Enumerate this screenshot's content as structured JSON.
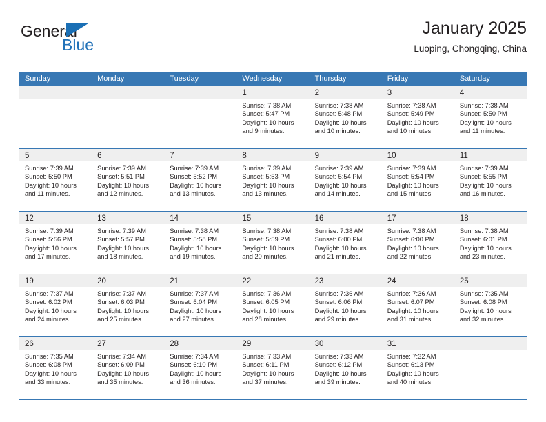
{
  "brand": {
    "name_part1": "General",
    "name_part2": "Blue",
    "colors": {
      "general": "#231f20",
      "blue": "#2272b8",
      "triangle": "#1a6fb5"
    }
  },
  "header": {
    "title": "January 2025",
    "subtitle": "Luoping, Chongqing, China"
  },
  "theme": {
    "header_row_bg": "#3878b4",
    "header_row_text": "#ffffff",
    "daynum_band_bg": "#efefef",
    "row_divider": "#3878b4",
    "text": "#231f20"
  },
  "calendar": {
    "weekday_headers": [
      "Sunday",
      "Monday",
      "Tuesday",
      "Wednesday",
      "Thursday",
      "Friday",
      "Saturday"
    ],
    "weeks": [
      [
        {
          "day": "",
          "lines": []
        },
        {
          "day": "",
          "lines": []
        },
        {
          "day": "",
          "lines": []
        },
        {
          "day": "1",
          "lines": [
            "Sunrise: 7:38 AM",
            "Sunset: 5:47 PM",
            "Daylight: 10 hours",
            "and 9 minutes."
          ]
        },
        {
          "day": "2",
          "lines": [
            "Sunrise: 7:38 AM",
            "Sunset: 5:48 PM",
            "Daylight: 10 hours",
            "and 10 minutes."
          ]
        },
        {
          "day": "3",
          "lines": [
            "Sunrise: 7:38 AM",
            "Sunset: 5:49 PM",
            "Daylight: 10 hours",
            "and 10 minutes."
          ]
        },
        {
          "day": "4",
          "lines": [
            "Sunrise: 7:38 AM",
            "Sunset: 5:50 PM",
            "Daylight: 10 hours",
            "and 11 minutes."
          ]
        }
      ],
      [
        {
          "day": "5",
          "lines": [
            "Sunrise: 7:39 AM",
            "Sunset: 5:50 PM",
            "Daylight: 10 hours",
            "and 11 minutes."
          ]
        },
        {
          "day": "6",
          "lines": [
            "Sunrise: 7:39 AM",
            "Sunset: 5:51 PM",
            "Daylight: 10 hours",
            "and 12 minutes."
          ]
        },
        {
          "day": "7",
          "lines": [
            "Sunrise: 7:39 AM",
            "Sunset: 5:52 PM",
            "Daylight: 10 hours",
            "and 13 minutes."
          ]
        },
        {
          "day": "8",
          "lines": [
            "Sunrise: 7:39 AM",
            "Sunset: 5:53 PM",
            "Daylight: 10 hours",
            "and 13 minutes."
          ]
        },
        {
          "day": "9",
          "lines": [
            "Sunrise: 7:39 AM",
            "Sunset: 5:54 PM",
            "Daylight: 10 hours",
            "and 14 minutes."
          ]
        },
        {
          "day": "10",
          "lines": [
            "Sunrise: 7:39 AM",
            "Sunset: 5:54 PM",
            "Daylight: 10 hours",
            "and 15 minutes."
          ]
        },
        {
          "day": "11",
          "lines": [
            "Sunrise: 7:39 AM",
            "Sunset: 5:55 PM",
            "Daylight: 10 hours",
            "and 16 minutes."
          ]
        }
      ],
      [
        {
          "day": "12",
          "lines": [
            "Sunrise: 7:39 AM",
            "Sunset: 5:56 PM",
            "Daylight: 10 hours",
            "and 17 minutes."
          ]
        },
        {
          "day": "13",
          "lines": [
            "Sunrise: 7:39 AM",
            "Sunset: 5:57 PM",
            "Daylight: 10 hours",
            "and 18 minutes."
          ]
        },
        {
          "day": "14",
          "lines": [
            "Sunrise: 7:38 AM",
            "Sunset: 5:58 PM",
            "Daylight: 10 hours",
            "and 19 minutes."
          ]
        },
        {
          "day": "15",
          "lines": [
            "Sunrise: 7:38 AM",
            "Sunset: 5:59 PM",
            "Daylight: 10 hours",
            "and 20 minutes."
          ]
        },
        {
          "day": "16",
          "lines": [
            "Sunrise: 7:38 AM",
            "Sunset: 6:00 PM",
            "Daylight: 10 hours",
            "and 21 minutes."
          ]
        },
        {
          "day": "17",
          "lines": [
            "Sunrise: 7:38 AM",
            "Sunset: 6:00 PM",
            "Daylight: 10 hours",
            "and 22 minutes."
          ]
        },
        {
          "day": "18",
          "lines": [
            "Sunrise: 7:38 AM",
            "Sunset: 6:01 PM",
            "Daylight: 10 hours",
            "and 23 minutes."
          ]
        }
      ],
      [
        {
          "day": "19",
          "lines": [
            "Sunrise: 7:37 AM",
            "Sunset: 6:02 PM",
            "Daylight: 10 hours",
            "and 24 minutes."
          ]
        },
        {
          "day": "20",
          "lines": [
            "Sunrise: 7:37 AM",
            "Sunset: 6:03 PM",
            "Daylight: 10 hours",
            "and 25 minutes."
          ]
        },
        {
          "day": "21",
          "lines": [
            "Sunrise: 7:37 AM",
            "Sunset: 6:04 PM",
            "Daylight: 10 hours",
            "and 27 minutes."
          ]
        },
        {
          "day": "22",
          "lines": [
            "Sunrise: 7:36 AM",
            "Sunset: 6:05 PM",
            "Daylight: 10 hours",
            "and 28 minutes."
          ]
        },
        {
          "day": "23",
          "lines": [
            "Sunrise: 7:36 AM",
            "Sunset: 6:06 PM",
            "Daylight: 10 hours",
            "and 29 minutes."
          ]
        },
        {
          "day": "24",
          "lines": [
            "Sunrise: 7:36 AM",
            "Sunset: 6:07 PM",
            "Daylight: 10 hours",
            "and 31 minutes."
          ]
        },
        {
          "day": "25",
          "lines": [
            "Sunrise: 7:35 AM",
            "Sunset: 6:08 PM",
            "Daylight: 10 hours",
            "and 32 minutes."
          ]
        }
      ],
      [
        {
          "day": "26",
          "lines": [
            "Sunrise: 7:35 AM",
            "Sunset: 6:08 PM",
            "Daylight: 10 hours",
            "and 33 minutes."
          ]
        },
        {
          "day": "27",
          "lines": [
            "Sunrise: 7:34 AM",
            "Sunset: 6:09 PM",
            "Daylight: 10 hours",
            "and 35 minutes."
          ]
        },
        {
          "day": "28",
          "lines": [
            "Sunrise: 7:34 AM",
            "Sunset: 6:10 PM",
            "Daylight: 10 hours",
            "and 36 minutes."
          ]
        },
        {
          "day": "29",
          "lines": [
            "Sunrise: 7:33 AM",
            "Sunset: 6:11 PM",
            "Daylight: 10 hours",
            "and 37 minutes."
          ]
        },
        {
          "day": "30",
          "lines": [
            "Sunrise: 7:33 AM",
            "Sunset: 6:12 PM",
            "Daylight: 10 hours",
            "and 39 minutes."
          ]
        },
        {
          "day": "31",
          "lines": [
            "Sunrise: 7:32 AM",
            "Sunset: 6:13 PM",
            "Daylight: 10 hours",
            "and 40 minutes."
          ]
        },
        {
          "day": "",
          "lines": []
        }
      ]
    ]
  }
}
